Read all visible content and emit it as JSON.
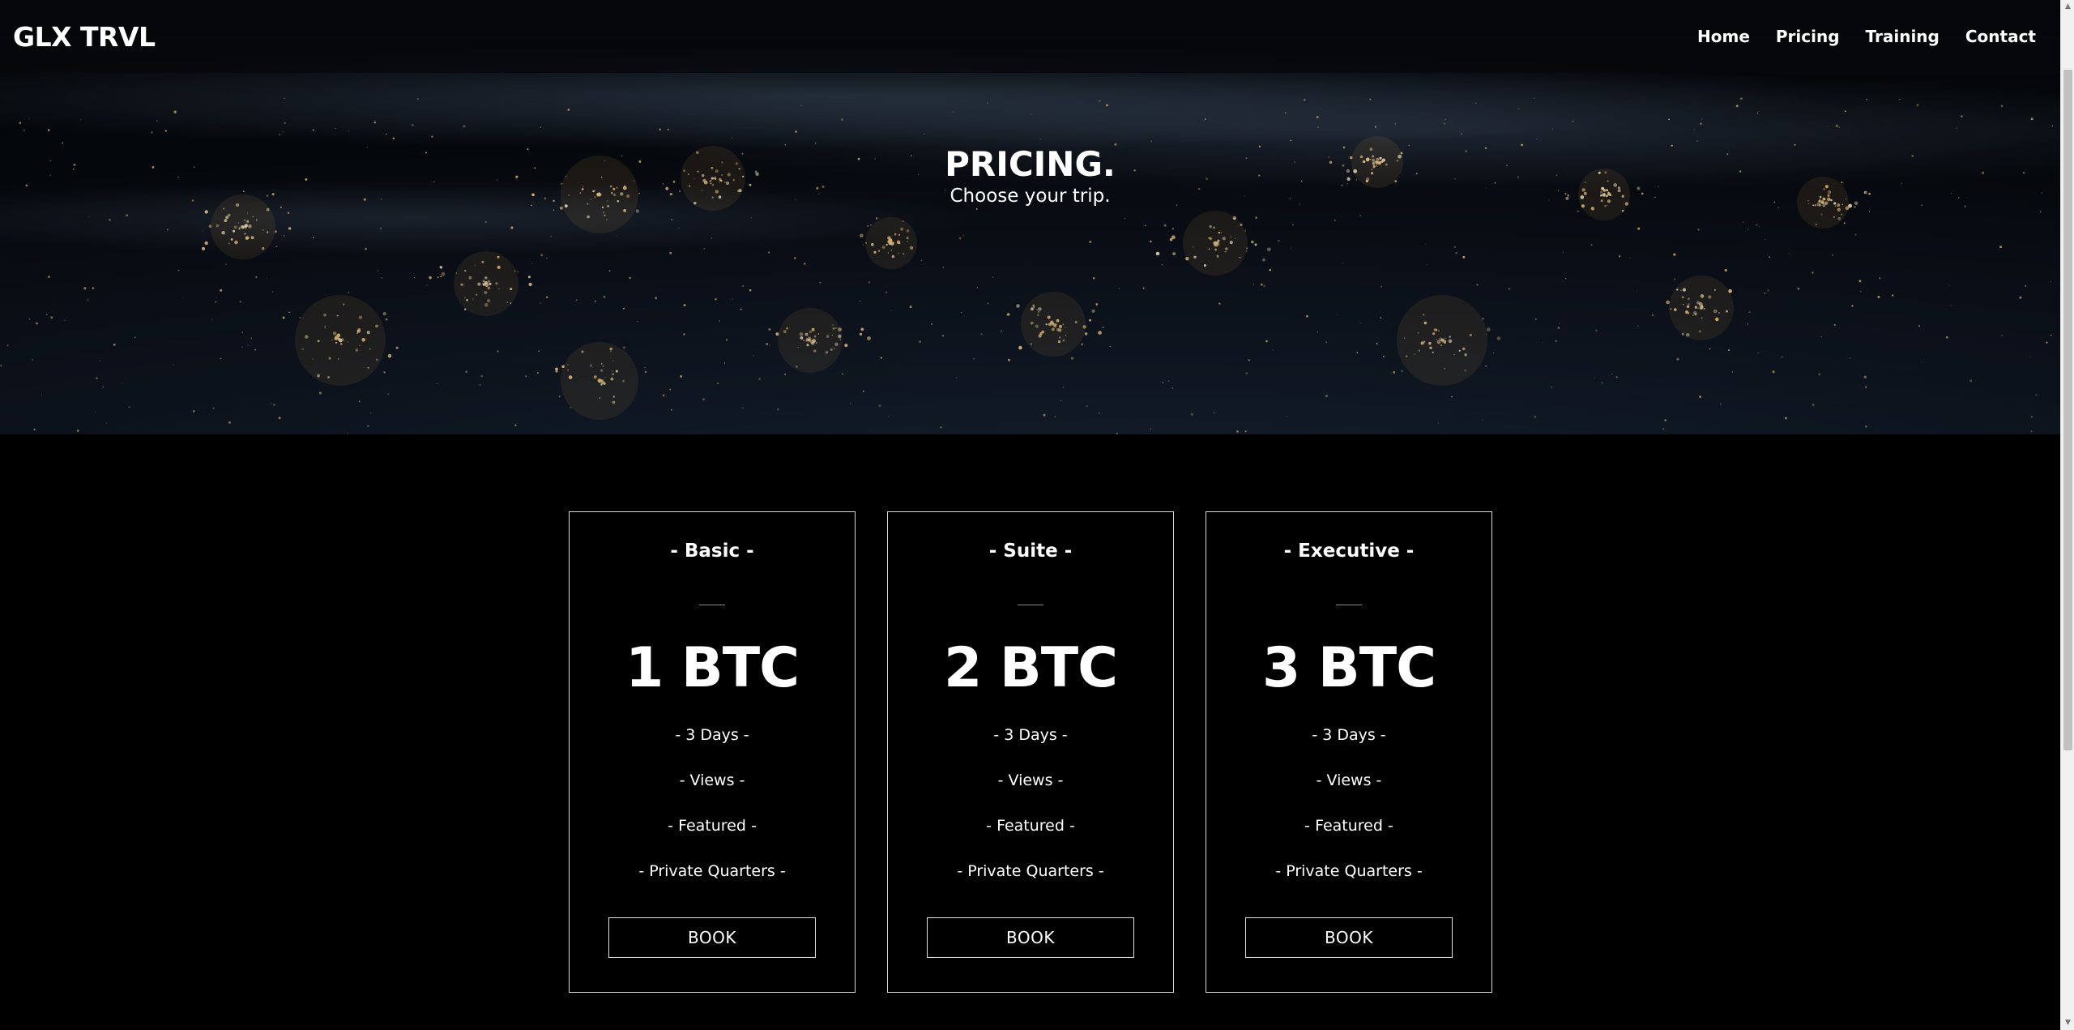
{
  "brand": "GLX TRVL",
  "nav": [
    {
      "label": "Home"
    },
    {
      "label": "Pricing"
    },
    {
      "label": "Training"
    },
    {
      "label": "Contact"
    }
  ],
  "hero": {
    "title": "PRICING.",
    "subtitle": "Choose your trip."
  },
  "plans": [
    {
      "name": "- Basic -",
      "price": "1 BTC",
      "features": [
        "- 3 Days -",
        "- Views -",
        "- Featured -",
        "- Private Quarters -"
      ],
      "button": "BOOK"
    },
    {
      "name": "- Suite -",
      "price": "2 BTC",
      "features": [
        "- 3 Days -",
        "- Views -",
        "- Featured -",
        "- Private Quarters -"
      ],
      "button": "BOOK"
    },
    {
      "name": "- Executive -",
      "price": "3 BTC",
      "features": [
        "- 3 Days -",
        "- Views -",
        "- Featured -",
        "- Private Quarters -"
      ],
      "button": "BOOK"
    }
  ]
}
